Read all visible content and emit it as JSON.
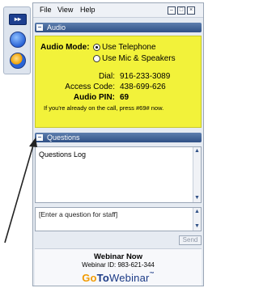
{
  "menu": {
    "file": "File",
    "view": "View",
    "help": "Help"
  },
  "side_toolbar": {
    "expand_label": "▸▸"
  },
  "audio": {
    "section_title": "Audio",
    "mode_label": "Audio Mode:",
    "option_telephone": "Use Telephone",
    "option_mic": "Use Mic & Speakers",
    "selected": "Use Telephone",
    "dial_label": "Dial:",
    "dial_value": "916-233-3089",
    "access_label": "Access Code:",
    "access_value": "438-699-626",
    "pin_label": "Audio PIN:",
    "pin_value": "69",
    "note": "If you're already on the call, press #69# now."
  },
  "questions": {
    "section_title": "Questions",
    "log_text": "Questions Log",
    "input_placeholder": "[Enter a question for staff]",
    "send_label": "Send"
  },
  "footer": {
    "title": "Webinar Now",
    "webinar_id": "Webinar ID: 983-621-344",
    "logo_go": "Go",
    "logo_to": "To",
    "logo_webinar": "Webinar",
    "logo_tm": "™"
  }
}
